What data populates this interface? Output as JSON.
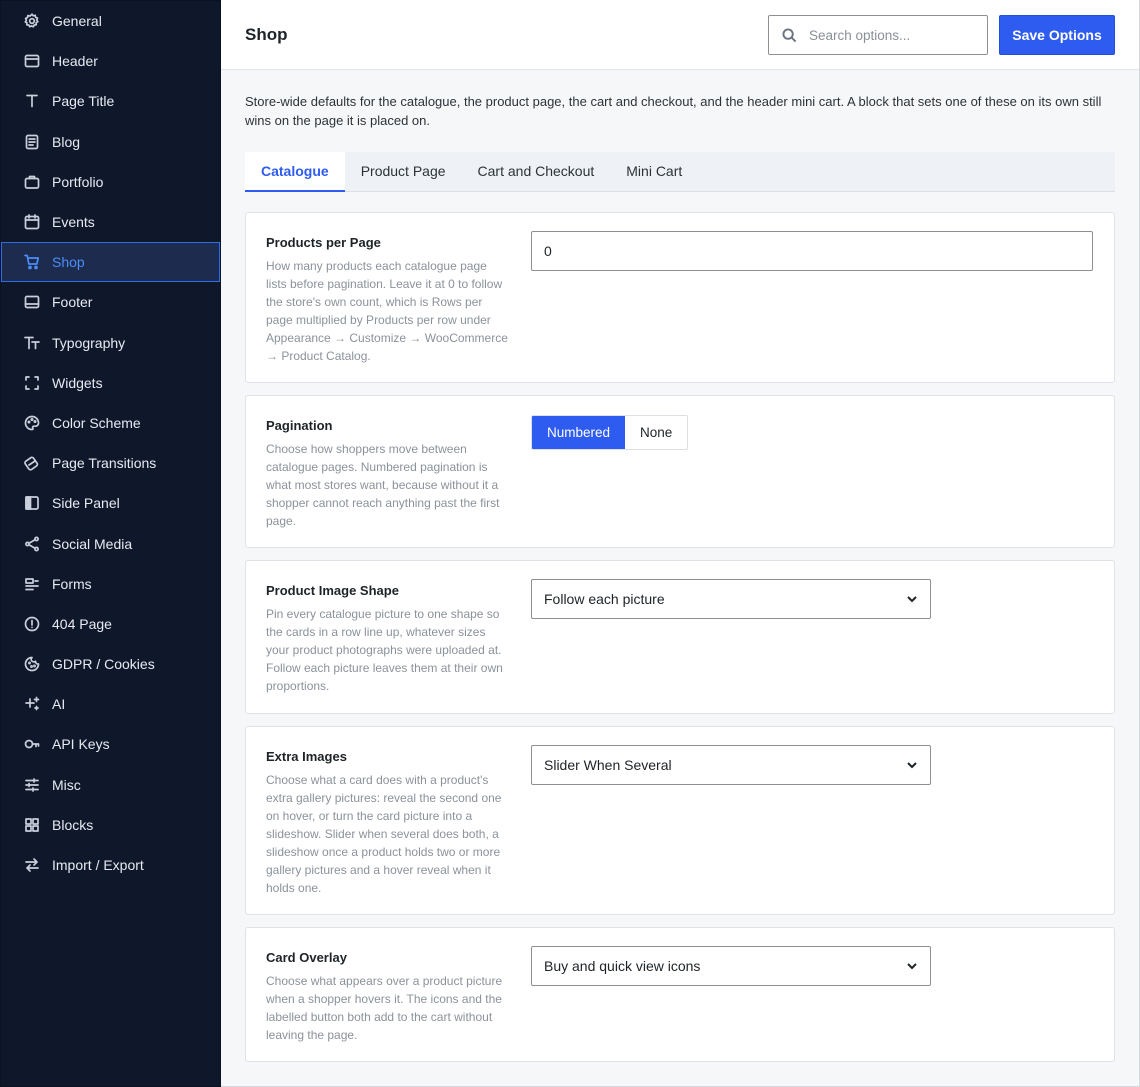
{
  "sidebar": {
    "items": [
      {
        "label": "General",
        "icon": "gear-icon"
      },
      {
        "label": "Header",
        "icon": "header-icon"
      },
      {
        "label": "Page Title",
        "icon": "text-t-icon"
      },
      {
        "label": "Blog",
        "icon": "document-icon"
      },
      {
        "label": "Portfolio",
        "icon": "briefcase-icon"
      },
      {
        "label": "Events",
        "icon": "calendar-icon"
      },
      {
        "label": "Shop",
        "icon": "cart-icon",
        "active": true
      },
      {
        "label": "Footer",
        "icon": "footer-icon"
      },
      {
        "label": "Typography",
        "icon": "typography-icon"
      },
      {
        "label": "Widgets",
        "icon": "widgets-icon"
      },
      {
        "label": "Color Scheme",
        "icon": "palette-icon"
      },
      {
        "label": "Page Transitions",
        "icon": "transitions-icon"
      },
      {
        "label": "Side Panel",
        "icon": "side-panel-icon"
      },
      {
        "label": "Social Media",
        "icon": "share-icon"
      },
      {
        "label": "Forms",
        "icon": "forms-icon"
      },
      {
        "label": "404 Page",
        "icon": "alert-icon"
      },
      {
        "label": "GDPR / Cookies",
        "icon": "cookie-icon"
      },
      {
        "label": "AI",
        "icon": "sparkle-icon"
      },
      {
        "label": "API Keys",
        "icon": "key-icon"
      },
      {
        "label": "Misc",
        "icon": "sliders-icon"
      },
      {
        "label": "Blocks",
        "icon": "blocks-icon"
      },
      {
        "label": "Import / Export",
        "icon": "arrows-icon"
      }
    ]
  },
  "header": {
    "title": "Shop",
    "search_placeholder": "Search options...",
    "save_label": "Save Options"
  },
  "intro": "Store-wide defaults for the catalogue, the product page, the cart and checkout, and the header mini cart. A block that sets one of these on its own still wins on the page it is placed on.",
  "tabs": [
    {
      "label": "Catalogue",
      "active": true
    },
    {
      "label": "Product Page"
    },
    {
      "label": "Cart and Checkout"
    },
    {
      "label": "Mini Cart"
    }
  ],
  "settings": {
    "products_per_page": {
      "label": "Products per Page",
      "desc": "How many products each catalogue page lists before pagination. Leave it at 0 to follow the store's own count, which is Rows per page multiplied by Products per row under Appearance → Customize → WooCommerce → Product Catalog.",
      "value": "0"
    },
    "pagination": {
      "label": "Pagination",
      "desc": "Choose how shoppers move between catalogue pages. Numbered pagination is what most stores want, because without it a shopper cannot reach anything past the first page.",
      "options": [
        "Numbered",
        "None"
      ],
      "selected": "Numbered"
    },
    "image_shape": {
      "label": "Product Image Shape",
      "desc": "Pin every catalogue picture to one shape so the cards in a row line up, whatever sizes your product photographs were uploaded at. Follow each picture leaves them at their own proportions.",
      "value": "Follow each picture"
    },
    "extra_images": {
      "label": "Extra Images",
      "desc": "Choose what a card does with a product's extra gallery pictures: reveal the second one on hover, or turn the card picture into a slideshow. Slider when several does both, a slideshow once a product holds two or more gallery pictures and a hover reveal when it holds one.",
      "value": "Slider When Several"
    },
    "card_overlay": {
      "label": "Card Overlay",
      "desc": "Choose what appears over a product picture when a shopper hovers it. The icons and the labelled button both add to the cart without leaving the page.",
      "value": "Buy and quick view icons"
    }
  },
  "colors": {
    "sidebar_bg": "#0f172a",
    "accent": "#2f5cf0",
    "active_nav_text": "#4d8df8"
  }
}
